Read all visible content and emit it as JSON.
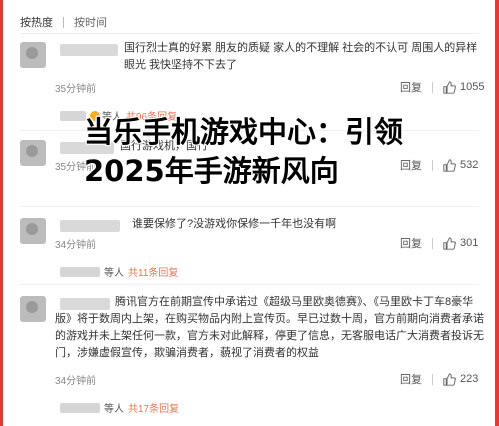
{
  "sort": {
    "hot_label": "按热度",
    "time_label": "按时间"
  },
  "comments": [
    {
      "text": "国行烈士真的好累 朋友的质疑 家人的不理解 社会的不认可 周围人的异样眼光 我快坚持不下去了",
      "time": "35分钟前",
      "reply_label": "回复",
      "likes": "1055",
      "sub_prefix": "等人",
      "sub_total": "共96条回复"
    },
    {
      "text": "国行游戏机，国行",
      "time": "35分钟前",
      "reply_label": "回复",
      "likes": "532"
    },
    {
      "text": "谁要保修了?没游戏你保修一千年也没有啊",
      "time": "34分钟前",
      "reply_label": "回复",
      "likes": "301",
      "sub_prefix": "等人",
      "sub_total": "共11条回复"
    },
    {
      "text": "腾讯官方在前期宣传中承诺过《超级马里欧奥德赛》、《马里欧卡丁车8豪华版》将于数周内上架，在购买物品内附上宣传页。早已过数十周，官方前期向消费者承诺的游戏并未上架任何一款，官方未对此解释，停更了信息，无客服电话广大消费者投诉无门，涉嫌虚假宣传，欺骗消费者，藐视了消费者的权益",
      "time": "34分钟前",
      "reply_label": "回复",
      "likes": "223",
      "sub_prefix": "等人",
      "sub_total": "共17条回复"
    }
  ],
  "overlay": {
    "title": "当乐手机游戏中心：引领2025年手游新风向"
  },
  "colors": {
    "accent": "#eb7350",
    "edge": "#e53935"
  }
}
